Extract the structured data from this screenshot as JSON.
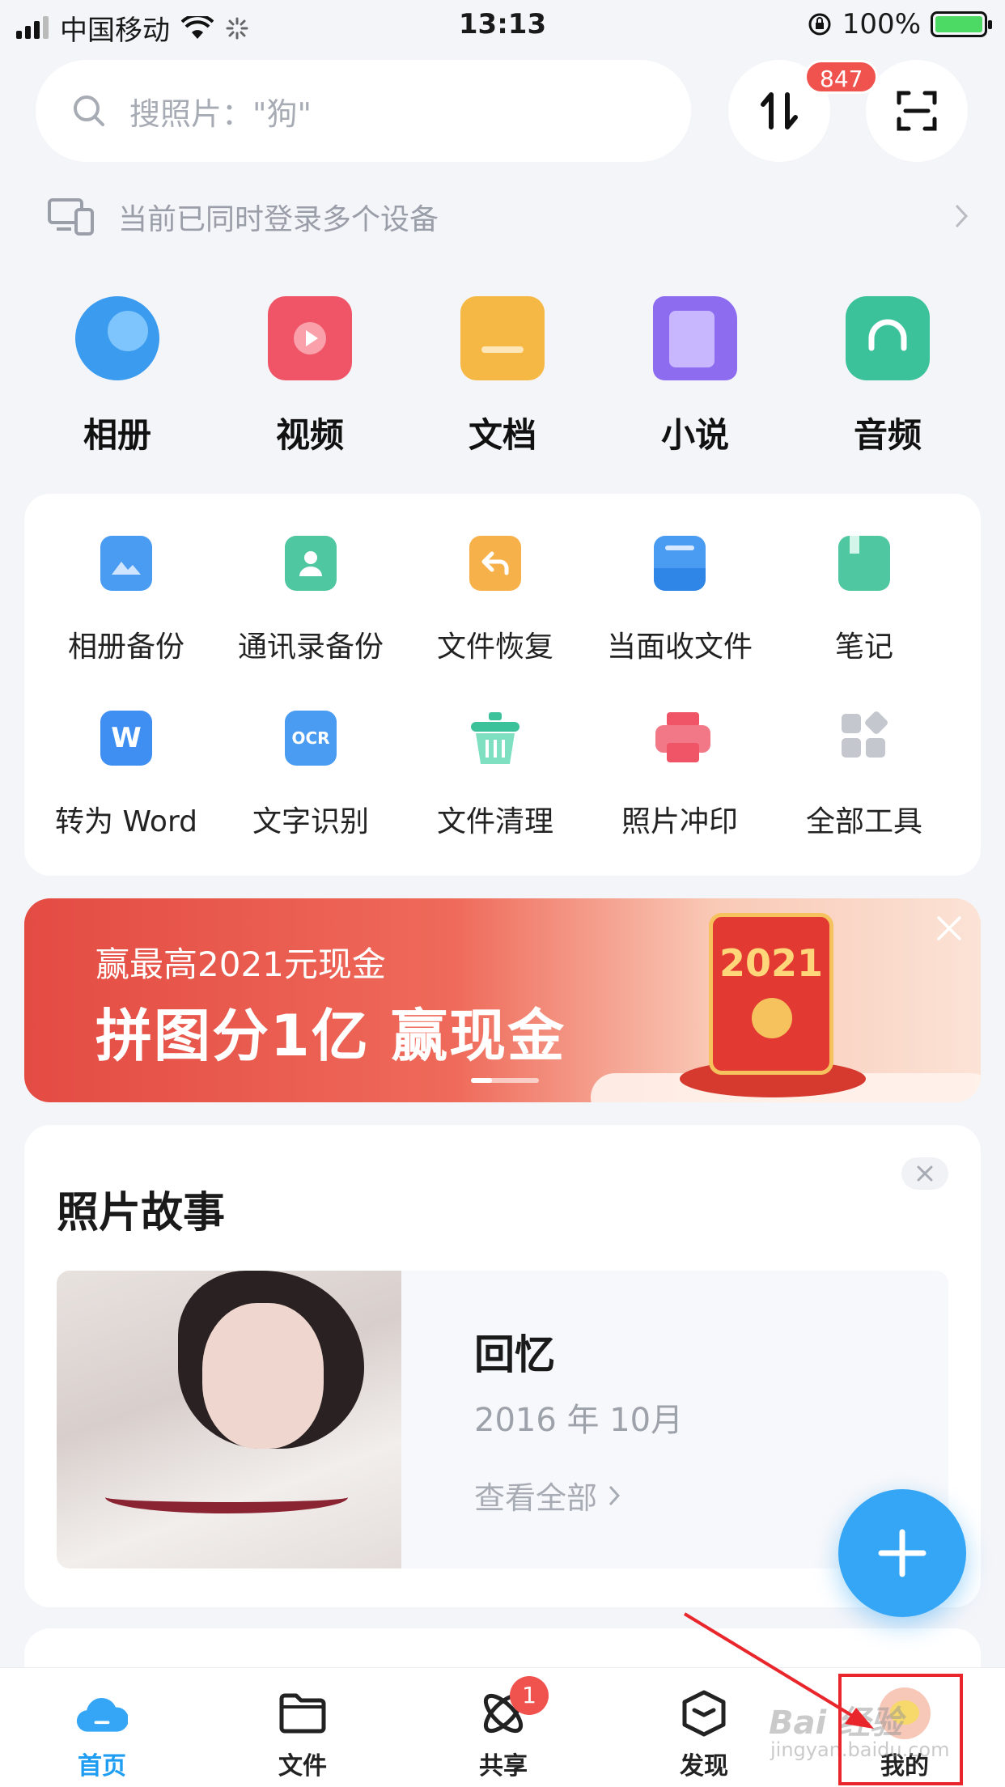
{
  "status_bar": {
    "carrier": "中国移动",
    "time": "13:13",
    "battery": "100%"
  },
  "search": {
    "placeholder": "搜照片：\"狗\""
  },
  "transfer": {
    "badge": "847"
  },
  "notice": {
    "text": "当前已同时登录多个设备"
  },
  "categories": [
    {
      "label": "相册",
      "icon": "album-icon",
      "color": "#3b9bef"
    },
    {
      "label": "视频",
      "icon": "video-icon",
      "color": "#ef5566"
    },
    {
      "label": "文档",
      "icon": "document-icon",
      "color": "#f6b845"
    },
    {
      "label": "小说",
      "icon": "book-icon",
      "color": "#8e6cf0"
    },
    {
      "label": "音频",
      "icon": "headphones-icon",
      "color": "#3cc29a"
    }
  ],
  "tools": [
    {
      "label": "相册备份",
      "icon": "album-backup-icon",
      "color": "#4a9cf3"
    },
    {
      "label": "通讯录备份",
      "icon": "contacts-backup-icon",
      "color": "#4fc7a0"
    },
    {
      "label": "文件恢复",
      "icon": "file-restore-icon",
      "color": "#f7b14b"
    },
    {
      "label": "当面收文件",
      "icon": "receive-file-icon",
      "color": "#4a9cf3"
    },
    {
      "label": "笔记",
      "icon": "note-icon",
      "color": "#4fc7a0"
    },
    {
      "label": "转为 Word",
      "icon": "word-icon",
      "color": "#3f8ff2"
    },
    {
      "label": "文字识别",
      "icon": "ocr-icon",
      "color": "#4a9cf3"
    },
    {
      "label": "文件清理",
      "icon": "clean-icon",
      "color": "#3cc29a"
    },
    {
      "label": "照片冲印",
      "icon": "print-icon",
      "color": "#ef5566"
    },
    {
      "label": "全部工具",
      "icon": "all-tools-icon",
      "color": "#c4c7ce"
    }
  ],
  "banner": {
    "subtitle": "赢最高2021元现金",
    "headline": "拼图分1亿 赢现金",
    "envelope_year": "2021"
  },
  "story": {
    "title": "照片故事",
    "item_title": "回忆",
    "item_date": "2016 年 10月",
    "view_all": "查看全部"
  },
  "tabs": [
    {
      "label": "首页",
      "active": true
    },
    {
      "label": "文件"
    },
    {
      "label": "共享",
      "badge": "1"
    },
    {
      "label": "发现"
    },
    {
      "label": "我的"
    }
  ],
  "watermark": {
    "text": "Bai 经验",
    "sub": "jingyan.baidu.com"
  },
  "colors": {
    "accent": "#1e9df2",
    "fab": "#35a6f5",
    "badge": "#f0524d",
    "annotation": "#e8262b"
  }
}
